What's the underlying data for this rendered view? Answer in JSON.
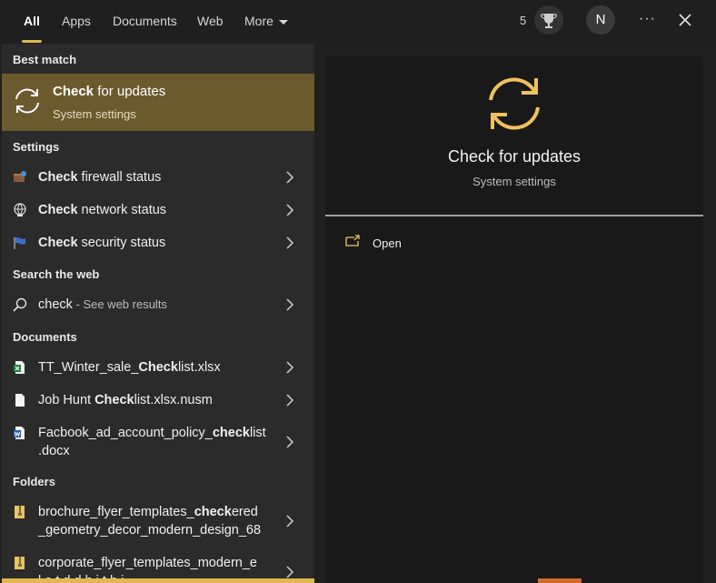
{
  "topbar": {
    "tabs": [
      "All",
      "Apps",
      "Documents",
      "Web",
      "More"
    ],
    "points": "5",
    "avatar_initial": "N",
    "more_options": "···"
  },
  "left": {
    "best_match_title": "Best match",
    "best_match": {
      "bold": "Check",
      "rest": " for updates",
      "subtitle": "System settings"
    },
    "settings_title": "Settings",
    "settings": [
      {
        "bold": "Check",
        "rest": " firewall status"
      },
      {
        "bold": "Check",
        "rest": " network status"
      },
      {
        "bold": "Check",
        "rest": " security status"
      }
    ],
    "web_title": "Search the web",
    "web_query": "check",
    "web_suffix": " - See web results",
    "documents_title": "Documents",
    "documents": [
      {
        "pre": "TT_Winter_sale_",
        "bold": "Check",
        "post": "list.xlsx"
      },
      {
        "pre": "Job Hunt ",
        "bold": "Check",
        "post": "list.xlsx.nusm"
      },
      {
        "line1_pre": "Facbook_ad_account_policy_",
        "line1_bold": "check",
        "line1_post": "list",
        "line2": ".docx"
      }
    ],
    "folders_title": "Folders",
    "folders": [
      {
        "line1_pre": "brochure_flyer_templates_",
        "line1_bold": "check",
        "line1_post": "ered",
        "line2": "_geometry_decor_modern_design_68"
      },
      {
        "line1": "corporate_flyer_templates_modern_e",
        "line2": "l e   t  d  d    h    i    t  h  i"
      }
    ]
  },
  "right": {
    "title": "Check for updates",
    "subtitle": "System settings",
    "open_label": "Open"
  },
  "colors": {
    "accent": "#e0b84f",
    "selection": "#6b5a2e"
  }
}
